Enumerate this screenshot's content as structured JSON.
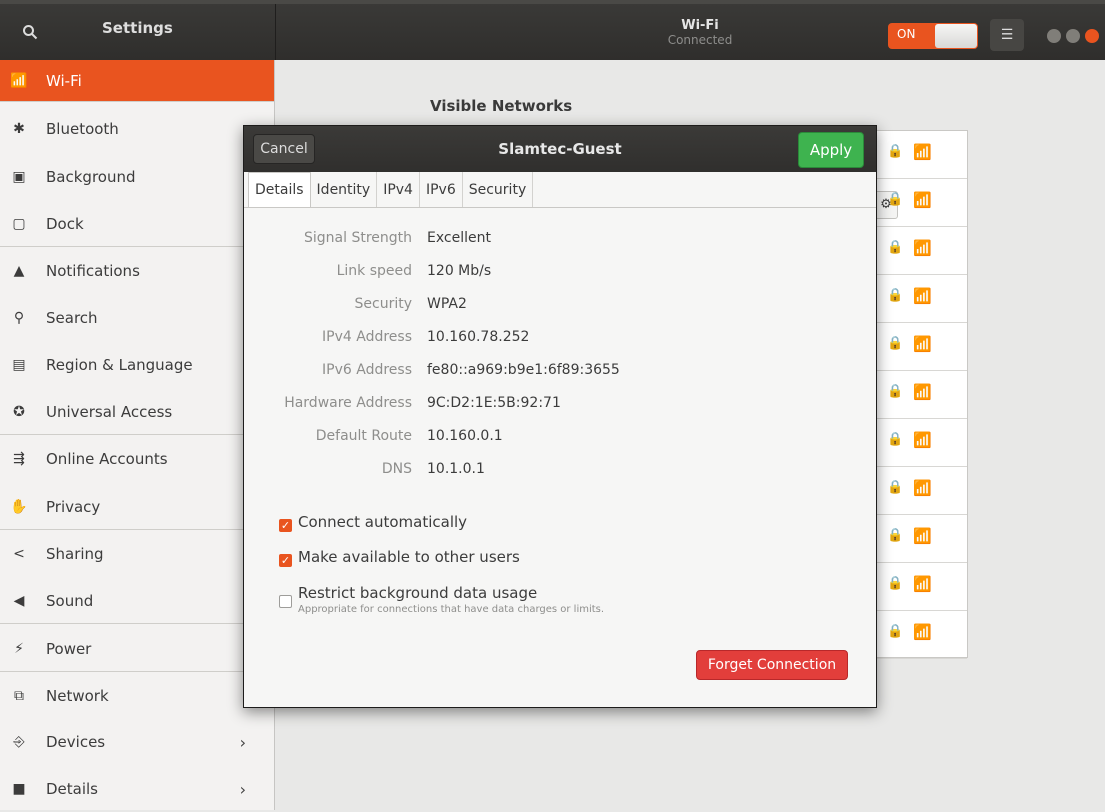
{
  "header": {
    "app_title": "Settings",
    "panel_title": "Wi-Fi",
    "panel_subtitle": "Connected",
    "wifi_switch_label": "ON",
    "accent_color": "#e9541f"
  },
  "sidebar": {
    "items": [
      {
        "label": "Wi-Fi",
        "icon": "wifi-icon",
        "glyph": "📶"
      },
      {
        "label": "Bluetooth",
        "icon": "bluetooth-icon",
        "glyph": "✱"
      },
      {
        "label": "Background",
        "icon": "background-icon",
        "glyph": "▣"
      },
      {
        "label": "Dock",
        "icon": "dock-icon",
        "glyph": "▢"
      },
      {
        "label": "Notifications",
        "icon": "bell-icon",
        "glyph": "▲"
      },
      {
        "label": "Search",
        "icon": "search-icon",
        "glyph": "⚲"
      },
      {
        "label": "Region & Language",
        "icon": "region-icon",
        "glyph": "▤"
      },
      {
        "label": "Universal Access",
        "icon": "accessibility-icon",
        "glyph": "✪"
      },
      {
        "label": "Online Accounts",
        "icon": "online-accounts-icon",
        "glyph": "⇶"
      },
      {
        "label": "Privacy",
        "icon": "privacy-hand-icon",
        "glyph": "✋"
      },
      {
        "label": "Sharing",
        "icon": "share-icon",
        "glyph": "<"
      },
      {
        "label": "Sound",
        "icon": "speaker-icon",
        "glyph": "◀"
      },
      {
        "label": "Power",
        "icon": "power-icon",
        "glyph": "⚡"
      },
      {
        "label": "Network",
        "icon": "network-icon",
        "glyph": "⧉"
      },
      {
        "label": "Devices",
        "icon": "devices-icon",
        "glyph": "⎆"
      },
      {
        "label": "Details",
        "icon": "details-icon",
        "glyph": "■"
      }
    ]
  },
  "main": {
    "section_title": "Visible Networks"
  },
  "dialog": {
    "cancel_label": "Cancel",
    "title": "Slamtec-Guest",
    "apply_label": "Apply",
    "tabs": [
      "Details",
      "Identity",
      "IPv4",
      "IPv6",
      "Security"
    ],
    "details": [
      {
        "key": "Signal Strength",
        "value": "Excellent"
      },
      {
        "key": "Link speed",
        "value": "120 Mb/s"
      },
      {
        "key": "Security",
        "value": "WPA2"
      },
      {
        "key": "IPv4 Address",
        "value": "10.160.78.252"
      },
      {
        "key": "IPv6 Address",
        "value": "fe80::a969:b9e1:6f89:3655"
      },
      {
        "key": "Hardware Address",
        "value": "9C:D2:1E:5B:92:71"
      },
      {
        "key": "Default Route",
        "value": "10.160.0.1"
      },
      {
        "key": "DNS",
        "value": "10.1.0.1"
      }
    ],
    "checkboxes": [
      {
        "label": "Connect automatically",
        "checked": true
      },
      {
        "label": "Make available to other users",
        "checked": true
      },
      {
        "label": "Restrict background data usage",
        "checked": false,
        "sublabel": "Appropriate for connections that have data charges or limits."
      }
    ],
    "forget_label": "Forget Connection"
  }
}
